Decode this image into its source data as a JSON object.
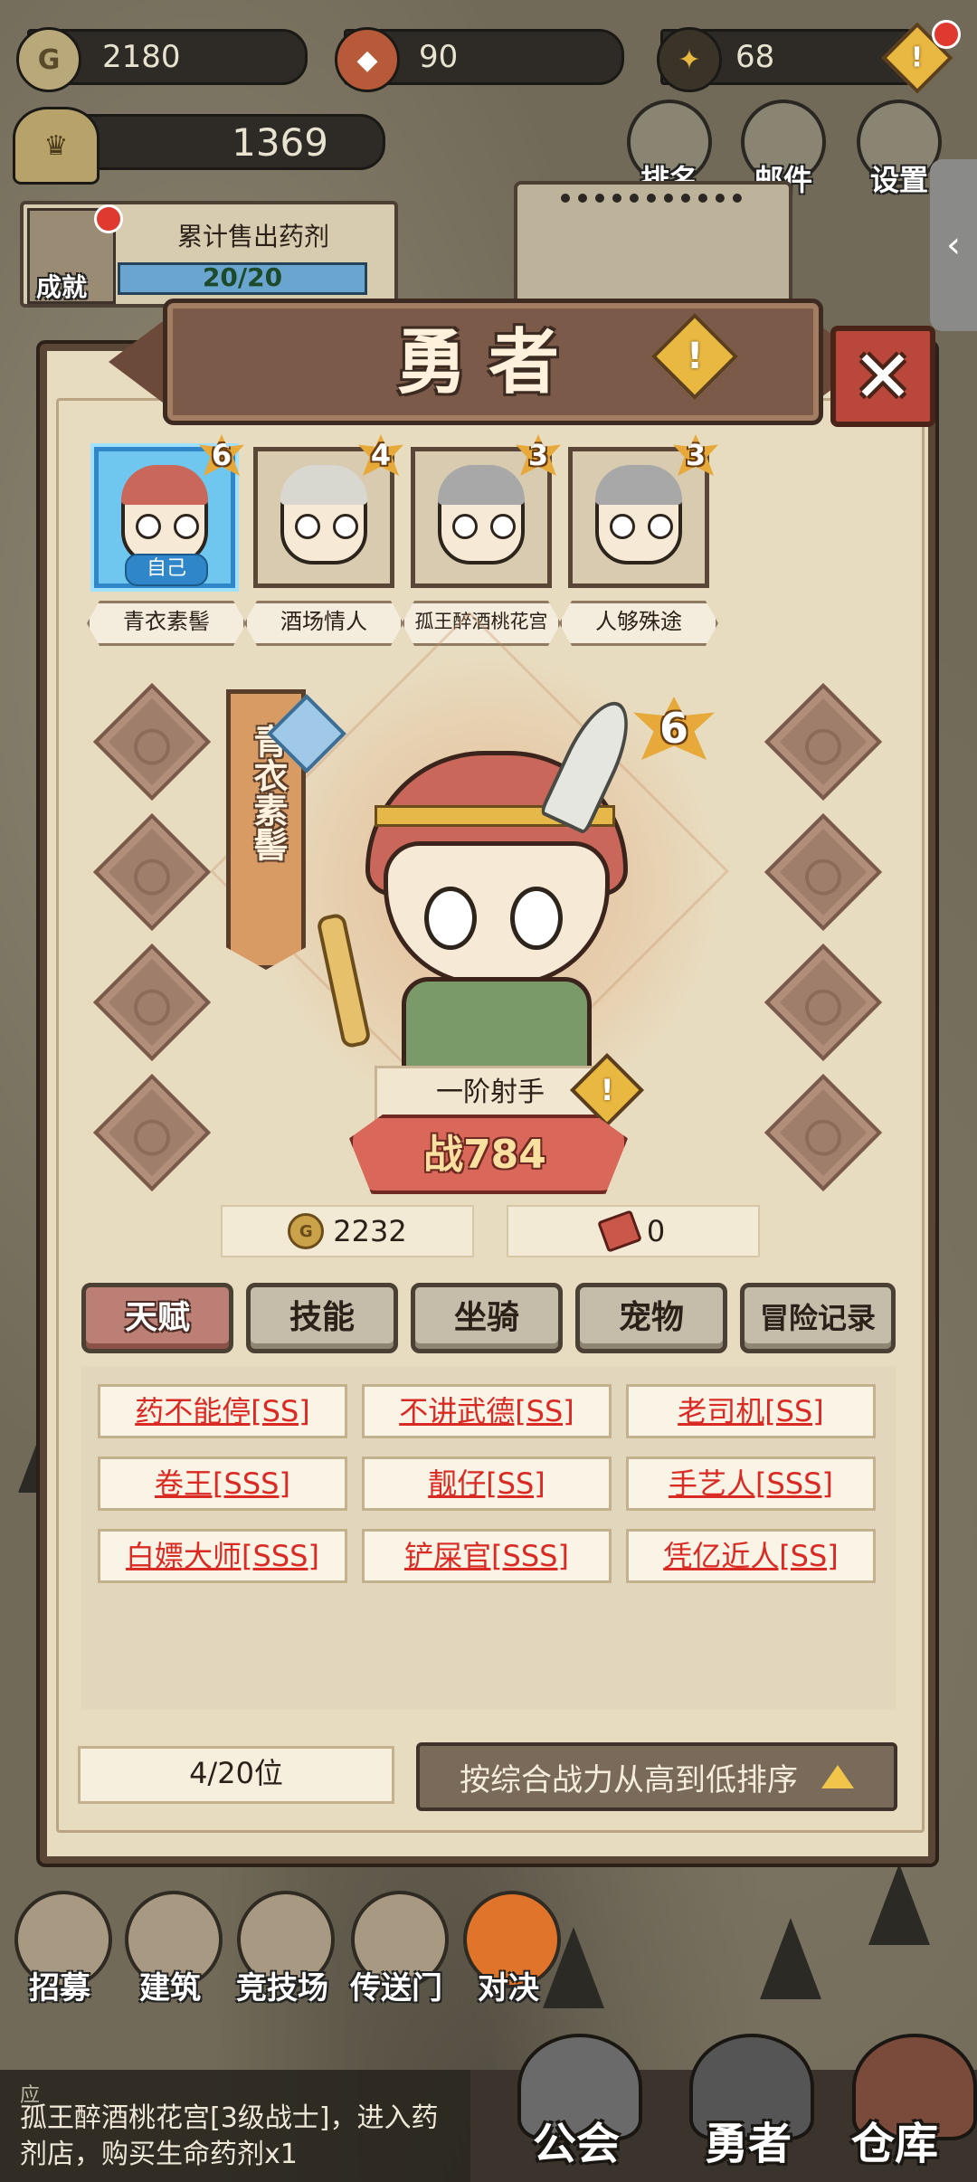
{
  "resources": {
    "gold": "2180",
    "shield": "90",
    "gem": "68",
    "score": "1369"
  },
  "top_buttons": {
    "rank": "排名",
    "mail": "邮件",
    "settings": "设置"
  },
  "achievement": {
    "label": "成就",
    "title": "累计售出药剂",
    "progress_text": "20/20",
    "progress": 1.0
  },
  "panel": {
    "title": "勇者",
    "close": "✕"
  },
  "heroes": [
    {
      "name": "青衣素髻",
      "level": "6",
      "self_tag": "自己",
      "hair": "#c9685a",
      "selected": true
    },
    {
      "name": "酒场情人",
      "level": "4",
      "hair": "#d8d8d0",
      "selected": false
    },
    {
      "name": "孤王醉酒桃花宫",
      "level": "3",
      "hair": "#a8a8a8",
      "selected": false
    },
    {
      "name": "人够殊途",
      "level": "3",
      "hair": "#a8a8a8",
      "selected": false
    }
  ],
  "hero_detail": {
    "name": "青衣素髻",
    "level": "6",
    "class_name": "一阶射手",
    "power_label": "战",
    "power": "784",
    "gold": "2232",
    "tickets": "0"
  },
  "tabs": [
    "天赋",
    "技能",
    "坐骑",
    "宠物",
    "冒险记录"
  ],
  "talents": [
    "药不能停[SS]",
    "不讲武德[SS]",
    "老司机[SS]",
    "卷王[SSS]",
    "靓仔[SS]",
    "手艺人[SSS]",
    "白嫖大师[SSS]",
    "铲屎官[SSS]",
    "凭亿近人[SS]"
  ],
  "footer": {
    "page_count": "4/20位",
    "sort_label": "按综合战力从高到低排序"
  },
  "bottom_nav": [
    "招募",
    "建筑",
    "竞技场",
    "传送门",
    "对决"
  ],
  "main_nav": [
    "公会",
    "勇者",
    "仓库"
  ],
  "message": {
    "header": "应",
    "text": "孤王醉酒桃花宫[3级战士]，进入药剂店，购买生命药剂x1"
  },
  "side_tab_icon": "‹",
  "colors": {
    "talent_text": "#d92a24",
    "selected_frame": "#2f86c8",
    "active_tab": "#bb7f75"
  }
}
